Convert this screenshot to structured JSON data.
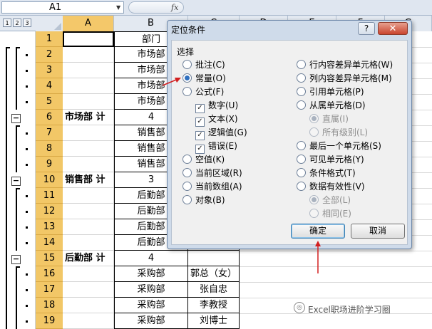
{
  "name_box": "A1",
  "fx_label": "fx",
  "outline_levels": [
    "1",
    "2",
    "3"
  ],
  "columns": [
    "A",
    "B",
    "C",
    "D",
    "E",
    "F",
    "G"
  ],
  "rows": [
    {
      "num": "1",
      "a": "",
      "b": "部门",
      "c": ""
    },
    {
      "num": "2",
      "a": "",
      "b": "市场部",
      "c": ""
    },
    {
      "num": "3",
      "a": "",
      "b": "市场部",
      "c": ""
    },
    {
      "num": "4",
      "a": "",
      "b": "市场部",
      "c": ""
    },
    {
      "num": "5",
      "a": "",
      "b": "市场部",
      "c": ""
    },
    {
      "num": "6",
      "a": "市场部 计",
      "b": "4",
      "c": ""
    },
    {
      "num": "7",
      "a": "",
      "b": "销售部",
      "c": ""
    },
    {
      "num": "8",
      "a": "",
      "b": "销售部",
      "c": ""
    },
    {
      "num": "9",
      "a": "",
      "b": "销售部",
      "c": ""
    },
    {
      "num": "10",
      "a": "销售部 计",
      "b": "3",
      "c": ""
    },
    {
      "num": "11",
      "a": "",
      "b": "后勤部",
      "c": ""
    },
    {
      "num": "12",
      "a": "",
      "b": "后勤部",
      "c": ""
    },
    {
      "num": "13",
      "a": "",
      "b": "后勤部",
      "c": ""
    },
    {
      "num": "14",
      "a": "",
      "b": "后勤部",
      "c": ""
    },
    {
      "num": "15",
      "a": "后勤部 计",
      "b": "4",
      "c": ""
    },
    {
      "num": "16",
      "a": "",
      "b": "采购部",
      "c": "郭总（女）"
    },
    {
      "num": "17",
      "a": "",
      "b": "采购部",
      "c": "张自忠"
    },
    {
      "num": "18",
      "a": "",
      "b": "采购部",
      "c": "李教授"
    },
    {
      "num": "19",
      "a": "",
      "b": "采购部",
      "c": "刘博士"
    }
  ],
  "dialog": {
    "title": "定位条件",
    "help": "?",
    "close": "✕",
    "group_label": "选择",
    "left_options": [
      {
        "label": "批注(C)",
        "type": "radio",
        "checked": false,
        "disabled": false
      },
      {
        "label": "常量(O)",
        "type": "radio",
        "checked": true,
        "disabled": false
      },
      {
        "label": "公式(F)",
        "type": "radio",
        "checked": false,
        "disabled": false
      },
      {
        "label": "数字(U)",
        "type": "check",
        "checked": true,
        "disabled": false,
        "indent": true
      },
      {
        "label": "文本(X)",
        "type": "check",
        "checked": true,
        "disabled": false,
        "indent": true
      },
      {
        "label": "逻辑值(G)",
        "type": "check",
        "checked": true,
        "disabled": false,
        "indent": true
      },
      {
        "label": "错误(E)",
        "type": "check",
        "checked": true,
        "disabled": false,
        "indent": true
      },
      {
        "label": "空值(K)",
        "type": "radio",
        "checked": false,
        "disabled": false
      },
      {
        "label": "当前区域(R)",
        "type": "radio",
        "checked": false,
        "disabled": false
      },
      {
        "label": "当前数组(A)",
        "type": "radio",
        "checked": false,
        "disabled": false
      },
      {
        "label": "对象(B)",
        "type": "radio",
        "checked": false,
        "disabled": false
      }
    ],
    "right_options": [
      {
        "label": "行内容差异单元格(W)",
        "type": "radio",
        "checked": false,
        "disabled": false
      },
      {
        "label": "列内容差异单元格(M)",
        "type": "radio",
        "checked": false,
        "disabled": false
      },
      {
        "label": "引用单元格(P)",
        "type": "radio",
        "checked": false,
        "disabled": false
      },
      {
        "label": "从属单元格(D)",
        "type": "radio",
        "checked": false,
        "disabled": false
      },
      {
        "label": "直属(I)",
        "type": "radio",
        "checked": true,
        "disabled": true,
        "indent": true
      },
      {
        "label": "所有级别(L)",
        "type": "radio",
        "checked": false,
        "disabled": true,
        "indent": true
      },
      {
        "label": "最后一个单元格(S)",
        "type": "radio",
        "checked": false,
        "disabled": false
      },
      {
        "label": "可见单元格(Y)",
        "type": "radio",
        "checked": false,
        "disabled": false
      },
      {
        "label": "条件格式(T)",
        "type": "radio",
        "checked": false,
        "disabled": false
      },
      {
        "label": "数据有效性(V)",
        "type": "radio",
        "checked": false,
        "disabled": false
      },
      {
        "label": "全部(L)",
        "type": "radio",
        "checked": true,
        "disabled": true,
        "indent": true
      },
      {
        "label": "相同(E)",
        "type": "radio",
        "checked": false,
        "disabled": true,
        "indent": true
      }
    ],
    "ok": "确定",
    "cancel": "取消"
  },
  "watermark": "Excel职场进阶学习圈",
  "colors": {
    "row_header": "#f2c767",
    "dialog_bg": "#cfdbea",
    "annotation": "#d21f1f"
  }
}
